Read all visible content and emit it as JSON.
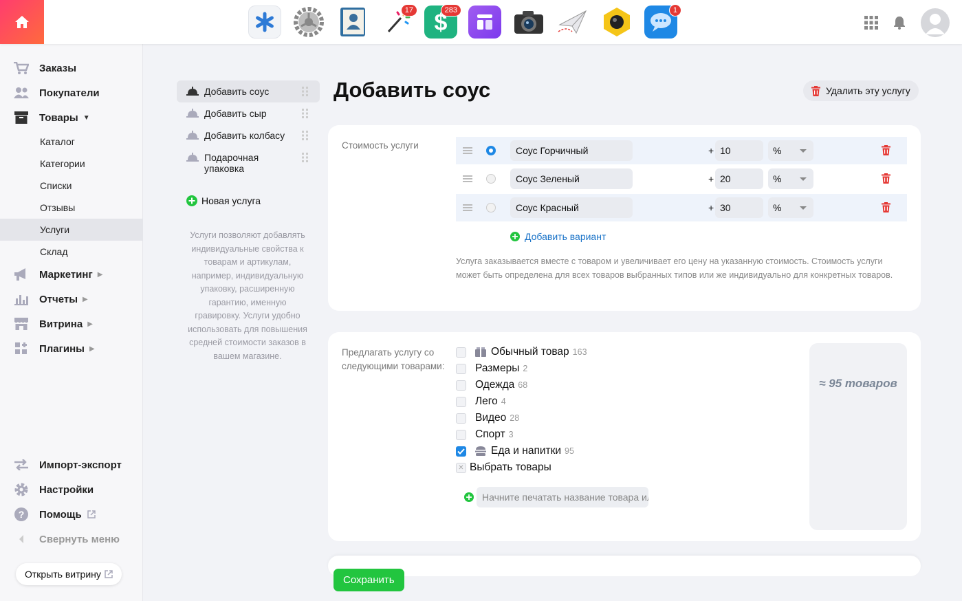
{
  "colors": {
    "accent": "#1e88e5",
    "danger": "#e53935",
    "success": "#22c53f",
    "brand_gradient_start": "#ff3d6e",
    "brand_gradient_end": "#ff6a3d"
  },
  "topbar": {
    "apps": [
      {
        "name": "asterisk-app",
        "badge": ""
      },
      {
        "name": "settings-gear-app",
        "badge": ""
      },
      {
        "name": "contacts-book-app",
        "badge": ""
      },
      {
        "name": "magic-wand-app",
        "badge": "17"
      },
      {
        "name": "dollar-shop-app",
        "badge": "283"
      },
      {
        "name": "site-builder-app",
        "badge": ""
      },
      {
        "name": "camera-app",
        "badge": ""
      },
      {
        "name": "paper-plane-app",
        "badge": ""
      },
      {
        "name": "hexagon-eye-app",
        "badge": ""
      },
      {
        "name": "messenger-app",
        "badge": "1"
      }
    ]
  },
  "sidebar": {
    "orders": "Заказы",
    "customers": "Покупатели",
    "products": "Товары",
    "catalog": "Каталог",
    "categories": "Категории",
    "lists": "Списки",
    "reviews": "Отзывы",
    "services": "Услуги",
    "stock": "Склад",
    "marketing": "Маркетинг",
    "reports": "Отчеты",
    "storefront": "Витрина",
    "plugins": "Плагины",
    "import_export": "Импорт-экспорт",
    "settings": "Настройки",
    "help": "Помощь",
    "collapse": "Свернуть меню",
    "open_store": "Открыть витрину"
  },
  "services": {
    "items": [
      "Добавить соус",
      "Добавить сыр",
      "Добавить колбасу",
      "Подарочная упаковка"
    ],
    "new_service": "Новая услуга",
    "note": "Услуги позволяют добавлять индивидуальные свойства к товарам и артикулам, например, индивидуальную упаковку, расширенную гарантию, именную гравировку. Услуги удобно использовать для повышения средней стоимости заказов в вашем магазине."
  },
  "main": {
    "title": "Добавить соус",
    "delete_service": "Удалить эту услугу",
    "cost_label": "Стоимость услуги",
    "variants": [
      {
        "name": "Соус Горчичный",
        "plus": "+",
        "price": "10",
        "unit": "%",
        "selected": true
      },
      {
        "name": "Соус Зеленый",
        "plus": "+",
        "price": "20",
        "unit": "%",
        "selected": false
      },
      {
        "name": "Соус Красный",
        "plus": "+",
        "price": "30",
        "unit": "%",
        "selected": false
      }
    ],
    "add_variant": "Добавить вариант",
    "hint": "Услуга заказывается вместе с товаром и увеличивает его цену на указанную стоимость. Стоимость услуги может быть определена для всех товаров выбранных типов или же индивидуально для конкретных товаров.",
    "offer_label": "Предлагать услугу со следующими товарами:",
    "types": [
      {
        "name": "Обычный товар",
        "count": "163",
        "checked": false,
        "icon": "box-icon"
      },
      {
        "name": "Размеры",
        "count": "2",
        "checked": false,
        "icon": ""
      },
      {
        "name": "Одежда",
        "count": "68",
        "checked": false,
        "icon": ""
      },
      {
        "name": "Лего",
        "count": "4",
        "checked": false,
        "icon": ""
      },
      {
        "name": "Видео",
        "count": "28",
        "checked": false,
        "icon": ""
      },
      {
        "name": "Спорт",
        "count": "3",
        "checked": false,
        "icon": ""
      },
      {
        "name": "Еда и напитки",
        "count": "95",
        "checked": true,
        "icon": "burger-icon"
      }
    ],
    "choose_products": "Выбрать товары",
    "search_placeholder": "Начните печатать название товара или артикул",
    "product_count": "≈ 95 товаров",
    "save": "Сохранить"
  }
}
